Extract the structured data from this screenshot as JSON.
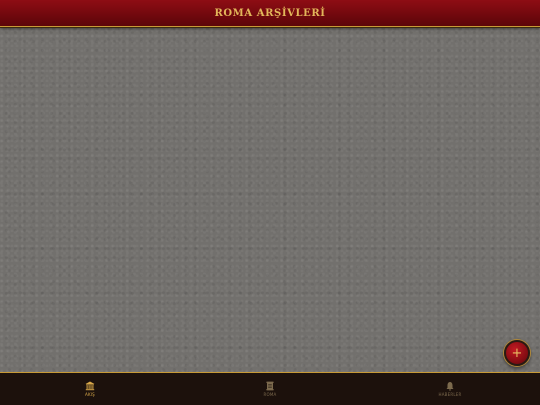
{
  "header": {
    "title": "ROMA ARŞİVLERİ"
  },
  "fab": {
    "label": "+"
  },
  "bottom_nav": {
    "items": [
      {
        "label": "AKIŞ",
        "icon": "temple-icon",
        "active": true
      },
      {
        "label": "ROMA",
        "icon": "scroll-icon",
        "active": false
      },
      {
        "label": "HABERLER",
        "icon": "bell-icon",
        "active": false
      }
    ]
  },
  "colors": {
    "header_red": "#8e0d14",
    "accent_gold": "#c79a36",
    "nav_bg": "#1c110c",
    "stone": "#72706d"
  }
}
